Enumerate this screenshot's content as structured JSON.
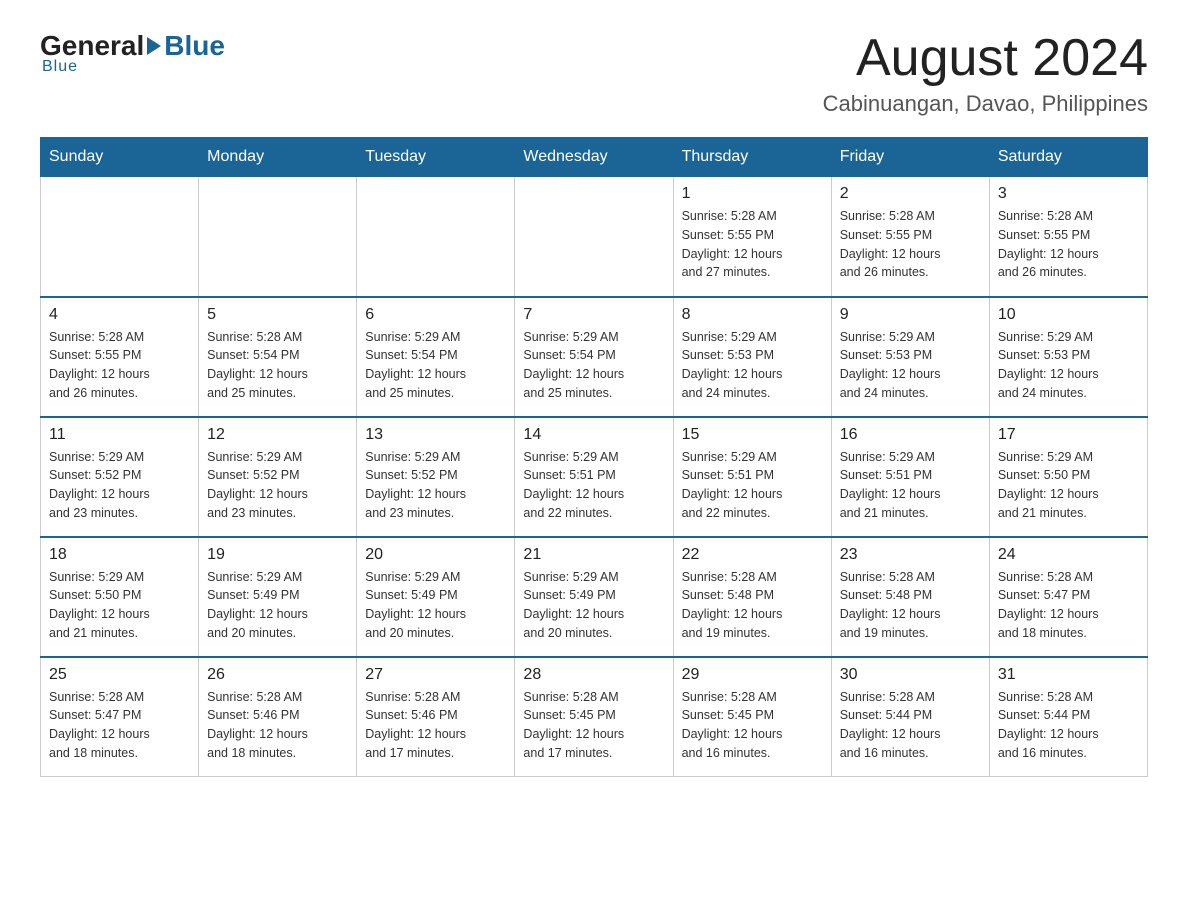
{
  "logo": {
    "general": "General",
    "blue": "Blue",
    "underline": "Blue"
  },
  "header": {
    "month": "August 2024",
    "location": "Cabinuangan, Davao, Philippines"
  },
  "days_of_week": [
    "Sunday",
    "Monday",
    "Tuesday",
    "Wednesday",
    "Thursday",
    "Friday",
    "Saturday"
  ],
  "weeks": [
    [
      {
        "day": "",
        "info": ""
      },
      {
        "day": "",
        "info": ""
      },
      {
        "day": "",
        "info": ""
      },
      {
        "day": "",
        "info": ""
      },
      {
        "day": "1",
        "info": "Sunrise: 5:28 AM\nSunset: 5:55 PM\nDaylight: 12 hours\nand 27 minutes."
      },
      {
        "day": "2",
        "info": "Sunrise: 5:28 AM\nSunset: 5:55 PM\nDaylight: 12 hours\nand 26 minutes."
      },
      {
        "day": "3",
        "info": "Sunrise: 5:28 AM\nSunset: 5:55 PM\nDaylight: 12 hours\nand 26 minutes."
      }
    ],
    [
      {
        "day": "4",
        "info": "Sunrise: 5:28 AM\nSunset: 5:55 PM\nDaylight: 12 hours\nand 26 minutes."
      },
      {
        "day": "5",
        "info": "Sunrise: 5:28 AM\nSunset: 5:54 PM\nDaylight: 12 hours\nand 25 minutes."
      },
      {
        "day": "6",
        "info": "Sunrise: 5:29 AM\nSunset: 5:54 PM\nDaylight: 12 hours\nand 25 minutes."
      },
      {
        "day": "7",
        "info": "Sunrise: 5:29 AM\nSunset: 5:54 PM\nDaylight: 12 hours\nand 25 minutes."
      },
      {
        "day": "8",
        "info": "Sunrise: 5:29 AM\nSunset: 5:53 PM\nDaylight: 12 hours\nand 24 minutes."
      },
      {
        "day": "9",
        "info": "Sunrise: 5:29 AM\nSunset: 5:53 PM\nDaylight: 12 hours\nand 24 minutes."
      },
      {
        "day": "10",
        "info": "Sunrise: 5:29 AM\nSunset: 5:53 PM\nDaylight: 12 hours\nand 24 minutes."
      }
    ],
    [
      {
        "day": "11",
        "info": "Sunrise: 5:29 AM\nSunset: 5:52 PM\nDaylight: 12 hours\nand 23 minutes."
      },
      {
        "day": "12",
        "info": "Sunrise: 5:29 AM\nSunset: 5:52 PM\nDaylight: 12 hours\nand 23 minutes."
      },
      {
        "day": "13",
        "info": "Sunrise: 5:29 AM\nSunset: 5:52 PM\nDaylight: 12 hours\nand 23 minutes."
      },
      {
        "day": "14",
        "info": "Sunrise: 5:29 AM\nSunset: 5:51 PM\nDaylight: 12 hours\nand 22 minutes."
      },
      {
        "day": "15",
        "info": "Sunrise: 5:29 AM\nSunset: 5:51 PM\nDaylight: 12 hours\nand 22 minutes."
      },
      {
        "day": "16",
        "info": "Sunrise: 5:29 AM\nSunset: 5:51 PM\nDaylight: 12 hours\nand 21 minutes."
      },
      {
        "day": "17",
        "info": "Sunrise: 5:29 AM\nSunset: 5:50 PM\nDaylight: 12 hours\nand 21 minutes."
      }
    ],
    [
      {
        "day": "18",
        "info": "Sunrise: 5:29 AM\nSunset: 5:50 PM\nDaylight: 12 hours\nand 21 minutes."
      },
      {
        "day": "19",
        "info": "Sunrise: 5:29 AM\nSunset: 5:49 PM\nDaylight: 12 hours\nand 20 minutes."
      },
      {
        "day": "20",
        "info": "Sunrise: 5:29 AM\nSunset: 5:49 PM\nDaylight: 12 hours\nand 20 minutes."
      },
      {
        "day": "21",
        "info": "Sunrise: 5:29 AM\nSunset: 5:49 PM\nDaylight: 12 hours\nand 20 minutes."
      },
      {
        "day": "22",
        "info": "Sunrise: 5:28 AM\nSunset: 5:48 PM\nDaylight: 12 hours\nand 19 minutes."
      },
      {
        "day": "23",
        "info": "Sunrise: 5:28 AM\nSunset: 5:48 PM\nDaylight: 12 hours\nand 19 minutes."
      },
      {
        "day": "24",
        "info": "Sunrise: 5:28 AM\nSunset: 5:47 PM\nDaylight: 12 hours\nand 18 minutes."
      }
    ],
    [
      {
        "day": "25",
        "info": "Sunrise: 5:28 AM\nSunset: 5:47 PM\nDaylight: 12 hours\nand 18 minutes."
      },
      {
        "day": "26",
        "info": "Sunrise: 5:28 AM\nSunset: 5:46 PM\nDaylight: 12 hours\nand 18 minutes."
      },
      {
        "day": "27",
        "info": "Sunrise: 5:28 AM\nSunset: 5:46 PM\nDaylight: 12 hours\nand 17 minutes."
      },
      {
        "day": "28",
        "info": "Sunrise: 5:28 AM\nSunset: 5:45 PM\nDaylight: 12 hours\nand 17 minutes."
      },
      {
        "day": "29",
        "info": "Sunrise: 5:28 AM\nSunset: 5:45 PM\nDaylight: 12 hours\nand 16 minutes."
      },
      {
        "day": "30",
        "info": "Sunrise: 5:28 AM\nSunset: 5:44 PM\nDaylight: 12 hours\nand 16 minutes."
      },
      {
        "day": "31",
        "info": "Sunrise: 5:28 AM\nSunset: 5:44 PM\nDaylight: 12 hours\nand 16 minutes."
      }
    ]
  ]
}
